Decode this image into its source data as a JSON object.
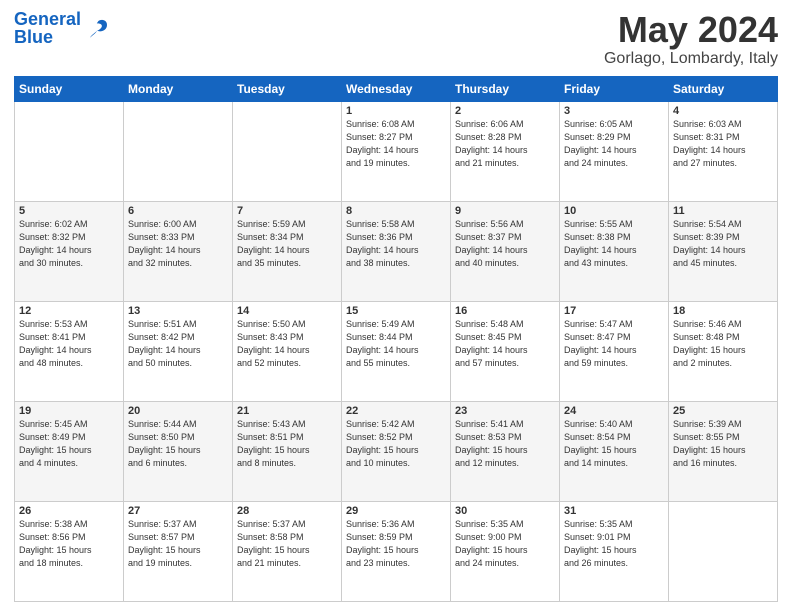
{
  "header": {
    "logo_general": "General",
    "logo_blue": "Blue",
    "month": "May 2024",
    "location": "Gorlago, Lombardy, Italy"
  },
  "days_of_week": [
    "Sunday",
    "Monday",
    "Tuesday",
    "Wednesday",
    "Thursday",
    "Friday",
    "Saturday"
  ],
  "weeks": [
    [
      {
        "day": "",
        "info": ""
      },
      {
        "day": "",
        "info": ""
      },
      {
        "day": "",
        "info": ""
      },
      {
        "day": "1",
        "info": "Sunrise: 6:08 AM\nSunset: 8:27 PM\nDaylight: 14 hours\nand 19 minutes."
      },
      {
        "day": "2",
        "info": "Sunrise: 6:06 AM\nSunset: 8:28 PM\nDaylight: 14 hours\nand 21 minutes."
      },
      {
        "day": "3",
        "info": "Sunrise: 6:05 AM\nSunset: 8:29 PM\nDaylight: 14 hours\nand 24 minutes."
      },
      {
        "day": "4",
        "info": "Sunrise: 6:03 AM\nSunset: 8:31 PM\nDaylight: 14 hours\nand 27 minutes."
      }
    ],
    [
      {
        "day": "5",
        "info": "Sunrise: 6:02 AM\nSunset: 8:32 PM\nDaylight: 14 hours\nand 30 minutes."
      },
      {
        "day": "6",
        "info": "Sunrise: 6:00 AM\nSunset: 8:33 PM\nDaylight: 14 hours\nand 32 minutes."
      },
      {
        "day": "7",
        "info": "Sunrise: 5:59 AM\nSunset: 8:34 PM\nDaylight: 14 hours\nand 35 minutes."
      },
      {
        "day": "8",
        "info": "Sunrise: 5:58 AM\nSunset: 8:36 PM\nDaylight: 14 hours\nand 38 minutes."
      },
      {
        "day": "9",
        "info": "Sunrise: 5:56 AM\nSunset: 8:37 PM\nDaylight: 14 hours\nand 40 minutes."
      },
      {
        "day": "10",
        "info": "Sunrise: 5:55 AM\nSunset: 8:38 PM\nDaylight: 14 hours\nand 43 minutes."
      },
      {
        "day": "11",
        "info": "Sunrise: 5:54 AM\nSunset: 8:39 PM\nDaylight: 14 hours\nand 45 minutes."
      }
    ],
    [
      {
        "day": "12",
        "info": "Sunrise: 5:53 AM\nSunset: 8:41 PM\nDaylight: 14 hours\nand 48 minutes."
      },
      {
        "day": "13",
        "info": "Sunrise: 5:51 AM\nSunset: 8:42 PM\nDaylight: 14 hours\nand 50 minutes."
      },
      {
        "day": "14",
        "info": "Sunrise: 5:50 AM\nSunset: 8:43 PM\nDaylight: 14 hours\nand 52 minutes."
      },
      {
        "day": "15",
        "info": "Sunrise: 5:49 AM\nSunset: 8:44 PM\nDaylight: 14 hours\nand 55 minutes."
      },
      {
        "day": "16",
        "info": "Sunrise: 5:48 AM\nSunset: 8:45 PM\nDaylight: 14 hours\nand 57 minutes."
      },
      {
        "day": "17",
        "info": "Sunrise: 5:47 AM\nSunset: 8:47 PM\nDaylight: 14 hours\nand 59 minutes."
      },
      {
        "day": "18",
        "info": "Sunrise: 5:46 AM\nSunset: 8:48 PM\nDaylight: 15 hours\nand 2 minutes."
      }
    ],
    [
      {
        "day": "19",
        "info": "Sunrise: 5:45 AM\nSunset: 8:49 PM\nDaylight: 15 hours\nand 4 minutes."
      },
      {
        "day": "20",
        "info": "Sunrise: 5:44 AM\nSunset: 8:50 PM\nDaylight: 15 hours\nand 6 minutes."
      },
      {
        "day": "21",
        "info": "Sunrise: 5:43 AM\nSunset: 8:51 PM\nDaylight: 15 hours\nand 8 minutes."
      },
      {
        "day": "22",
        "info": "Sunrise: 5:42 AM\nSunset: 8:52 PM\nDaylight: 15 hours\nand 10 minutes."
      },
      {
        "day": "23",
        "info": "Sunrise: 5:41 AM\nSunset: 8:53 PM\nDaylight: 15 hours\nand 12 minutes."
      },
      {
        "day": "24",
        "info": "Sunrise: 5:40 AM\nSunset: 8:54 PM\nDaylight: 15 hours\nand 14 minutes."
      },
      {
        "day": "25",
        "info": "Sunrise: 5:39 AM\nSunset: 8:55 PM\nDaylight: 15 hours\nand 16 minutes."
      }
    ],
    [
      {
        "day": "26",
        "info": "Sunrise: 5:38 AM\nSunset: 8:56 PM\nDaylight: 15 hours\nand 18 minutes."
      },
      {
        "day": "27",
        "info": "Sunrise: 5:37 AM\nSunset: 8:57 PM\nDaylight: 15 hours\nand 19 minutes."
      },
      {
        "day": "28",
        "info": "Sunrise: 5:37 AM\nSunset: 8:58 PM\nDaylight: 15 hours\nand 21 minutes."
      },
      {
        "day": "29",
        "info": "Sunrise: 5:36 AM\nSunset: 8:59 PM\nDaylight: 15 hours\nand 23 minutes."
      },
      {
        "day": "30",
        "info": "Sunrise: 5:35 AM\nSunset: 9:00 PM\nDaylight: 15 hours\nand 24 minutes."
      },
      {
        "day": "31",
        "info": "Sunrise: 5:35 AM\nSunset: 9:01 PM\nDaylight: 15 hours\nand 26 minutes."
      },
      {
        "day": "",
        "info": ""
      }
    ]
  ]
}
